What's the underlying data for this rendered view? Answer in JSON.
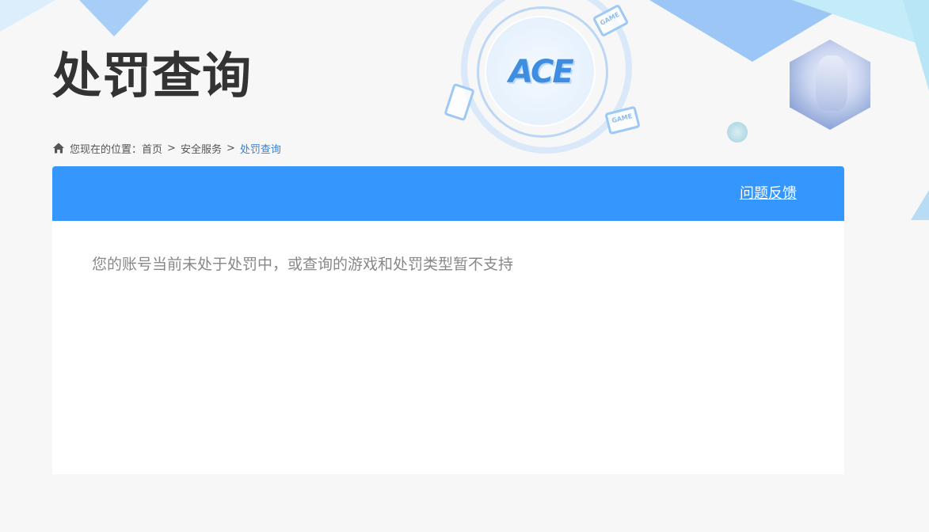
{
  "page": {
    "title": "处罚查询",
    "logo_text": "ACE",
    "device_label": "GAME"
  },
  "breadcrumb": {
    "prefix": "您现在的位置：",
    "items": [
      {
        "label": "首页"
      },
      {
        "label": "安全服务"
      },
      {
        "label": "处罚查询"
      }
    ],
    "separator": ">"
  },
  "panel": {
    "feedback_label": "问题反馈",
    "message": "您的账号当前未处于处罚中，或查询的游戏和处罚类型暂不支持"
  },
  "colors": {
    "header_blue": "#3596fd",
    "title": "#333333",
    "current_crumb": "#3a7fd0",
    "message_text": "#888888",
    "background": "#f7f7f7"
  },
  "icons": {
    "home": "home-icon"
  }
}
